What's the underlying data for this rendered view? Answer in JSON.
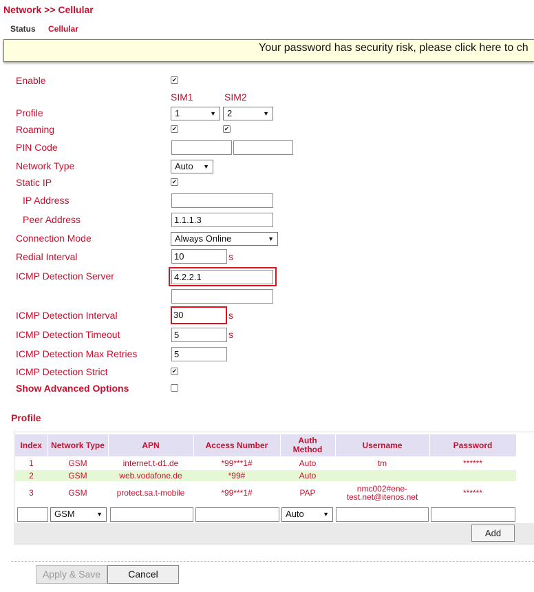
{
  "breadcrumb": "Network >> Cellular",
  "tabs": {
    "status": "Status",
    "cellular": "Cellular"
  },
  "banner": "Your password has security risk, please click here to ch",
  "form": {
    "enable_label": "Enable",
    "sim1_header": "SIM1",
    "sim2_header": "SIM2",
    "profile_label": "Profile",
    "profile_sim1": "1",
    "profile_sim2": "2",
    "roaming_label": "Roaming",
    "pin_label": "PIN Code",
    "network_type_label": "Network Type",
    "network_type_value": "Auto",
    "static_ip_label": "Static IP",
    "ip_address_label": "IP Address",
    "ip_address_value": "",
    "peer_address_label": "Peer Address",
    "peer_address_value": "1.1.1.3",
    "connection_mode_label": "Connection Mode",
    "connection_mode_value": "Always Online",
    "redial_label": "Redial Interval",
    "redial_value": "10",
    "icmp_server_label": "ICMP Detection Server",
    "icmp_server_value": "4.2.2.1",
    "icmp_server2_value": "",
    "icmp_interval_label": "ICMP Detection Interval",
    "icmp_interval_value": "30",
    "icmp_timeout_label": "ICMP Detection Timeout",
    "icmp_timeout_value": "5",
    "icmp_retries_label": "ICMP Detection Max Retries",
    "icmp_retries_value": "5",
    "icmp_strict_label": "ICMP Detection Strict",
    "advanced_label": "Show Advanced Options",
    "seconds_unit": "s",
    "checked_mark": "✔"
  },
  "profile_section": {
    "heading": "Profile",
    "columns": [
      "Index",
      "Network Type",
      "APN",
      "Access Number",
      "Auth Method",
      "Username",
      "Password"
    ],
    "rows": [
      [
        "1",
        "GSM",
        "internet.t-d1.de",
        "*99***1#",
        "Auto",
        "tm",
        "******"
      ],
      [
        "2",
        "GSM",
        "web.vodafone.de",
        "*99#",
        "Auto",
        "",
        ""
      ],
      [
        "3",
        "GSM",
        "protect.sa.t-mobile",
        "*99***1#",
        "PAP",
        "nmc002#ene-test.net@itenos.net",
        "******"
      ]
    ],
    "new_row": {
      "network_type": "GSM",
      "auth_method": "Auto"
    },
    "add_button": "Add"
  },
  "buttons": {
    "apply": "Apply & Save",
    "cancel": "Cancel"
  }
}
